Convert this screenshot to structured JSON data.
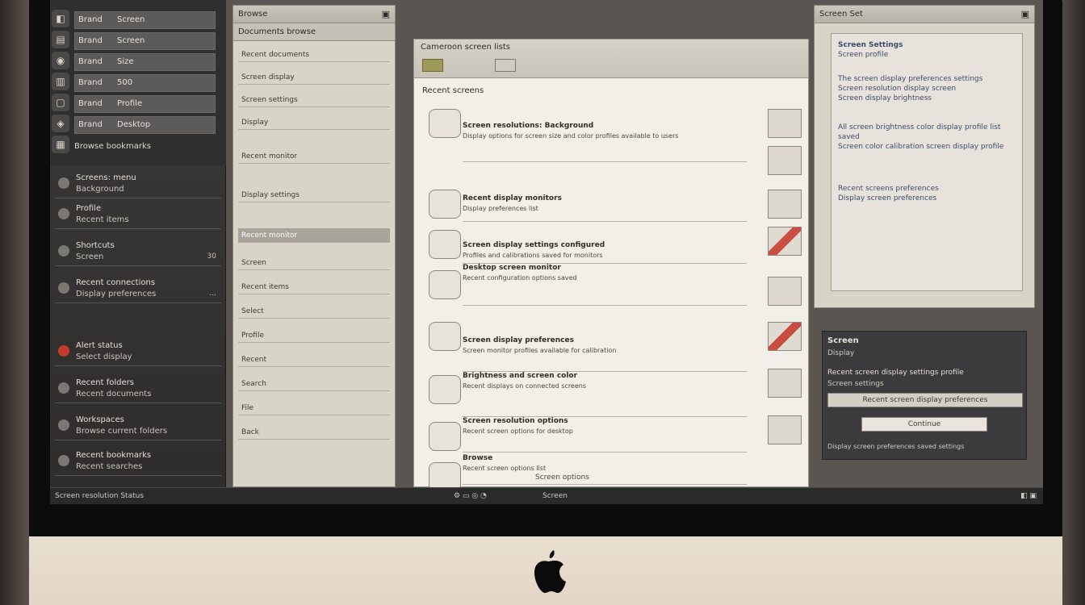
{
  "dock": {
    "tools": [
      "◧",
      "▤",
      "◉",
      "▥",
      "▢",
      "◈",
      "▦"
    ],
    "rows": [
      {
        "k": "Brand",
        "v": "Screen"
      },
      {
        "k": "Brand",
        "v": "Screen"
      },
      {
        "k": "Brand",
        "v": "Size"
      },
      {
        "k": "Brand",
        "v": "500"
      },
      {
        "k": "Brand",
        "v": "Profile"
      },
      {
        "k": "Brand",
        "v": "Desktop"
      }
    ],
    "footer": "Browse bookmarks"
  },
  "left_panel": {
    "items": [
      {
        "t1": "Screens: menu",
        "t2": "Background",
        "t3": ""
      },
      {
        "t1": "Profile",
        "t2": "Recent items",
        "t3": ""
      },
      {
        "t1": "Shortcuts",
        "t2": "Screen",
        "t3": "30"
      },
      {
        "t1": "Recent connections",
        "t2": "Display preferences",
        "t3": "..."
      },
      {
        "t1": "Alert status",
        "t2": "Select display",
        "t3": ""
      },
      {
        "t1": "Recent folders",
        "t2": "Recent documents",
        "t3": ""
      },
      {
        "t1": "Workspaces",
        "t2": "Browse current folders",
        "t3": ""
      },
      {
        "t1": "Recent bookmarks",
        "t2": "Recent searches",
        "t3": ""
      }
    ]
  },
  "pane_a": {
    "title": "Browse",
    "sub": "Documents browse",
    "rows": [
      "Recent documents",
      "Screen display",
      "Screen settings",
      "Display",
      "Recent monitor",
      "Display settings"
    ],
    "sel_row": "Recent monitor",
    "items": [
      "Screen",
      "Recent items",
      "Select",
      "Profile",
      "Recent",
      "Search",
      "File",
      "Back"
    ]
  },
  "main": {
    "toolbar_title": "Cameroon screen lists",
    "header": "Recent screens",
    "rows": [
      {
        "a": "Screen resolutions: Background",
        "b": "Display options for screen size and color profiles available to users"
      },
      {
        "a": "Recent display monitors",
        "b": "Display preferences list"
      },
      {
        "a": "Screen display settings configured",
        "b": "Profiles and calibrations saved for monitors"
      },
      {
        "a": "Desktop screen monitor",
        "b": "Recent configuration options saved"
      },
      {
        "a": "Screen display preferences",
        "b": "Screen monitor profiles available for calibration"
      },
      {
        "a": "Brightness and screen color",
        "b": "Recent displays on connected screens"
      },
      {
        "a": "Screen resolution options",
        "b": "Recent screen options for desktop"
      },
      {
        "a": "Browse",
        "b": "Recent screen options list"
      }
    ],
    "status": "Screen options"
  },
  "right_panel": {
    "title": "Screen Set",
    "lines": [
      "Screen Settings",
      "Screen profile",
      "The screen display preferences settings",
      "Screen resolution display screen",
      "Screen display brightness",
      "All screen brightness color display profile list saved",
      "Screen color calibration screen display profile",
      "Recent screens preferences",
      "Display screen preferences"
    ],
    "dark": {
      "title": "Screen",
      "sub": "Display",
      "line": "Recent screen display settings profile",
      "label": "Screen settings",
      "bar": "Recent screen display preferences",
      "button": "Continue",
      "foot": "Display screen preferences saved settings"
    }
  },
  "taskbar": {
    "left": "Screen resolution Status",
    "center": "Screen"
  }
}
